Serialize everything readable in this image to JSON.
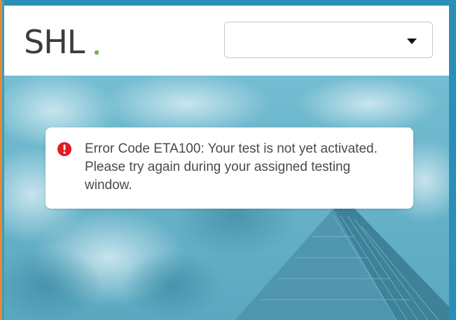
{
  "brand": {
    "logo_text": "SHL",
    "logo_dot_color": "#7ab648"
  },
  "language_select": {
    "value": ""
  },
  "alert": {
    "icon": "error-circle-icon",
    "message": "Error Code ETA100: Your test is not yet activated. Please try again during your assigned testing window."
  },
  "colors": {
    "frame": "#2a8fb8",
    "error": "#e01b24",
    "text": "#4a4a4a"
  }
}
